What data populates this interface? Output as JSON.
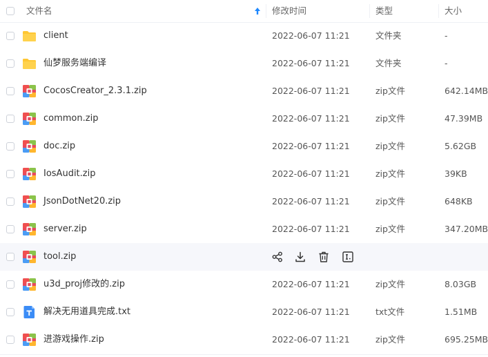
{
  "header": {
    "name": "文件名",
    "modified": "修改时间",
    "type": "类型",
    "size": "大小"
  },
  "actions": [
    "share-icon",
    "download-icon",
    "delete-icon",
    "more-icon"
  ],
  "files": [
    {
      "name": "client",
      "time": "2022-06-07 11:21",
      "type": "文件夹",
      "size": "-",
      "icon": "folder-icon"
    },
    {
      "name": "仙梦服务端编译",
      "time": "2022-06-07 11:21",
      "type": "文件夹",
      "size": "-",
      "icon": "folder-icon"
    },
    {
      "name": "CocosCreator_2.3.1.zip",
      "time": "2022-06-07 11:21",
      "type": "zip文件",
      "size": "642.14MB",
      "icon": "zip-icon"
    },
    {
      "name": "common.zip",
      "time": "2022-06-07 11:21",
      "type": "zip文件",
      "size": "47.39MB",
      "icon": "zip-icon"
    },
    {
      "name": "doc.zip",
      "time": "2022-06-07 11:21",
      "type": "zip文件",
      "size": "5.62GB",
      "icon": "zip-icon"
    },
    {
      "name": "IosAudit.zip",
      "time": "2022-06-07 11:21",
      "type": "zip文件",
      "size": "39KB",
      "icon": "zip-icon"
    },
    {
      "name": "JsonDotNet20.zip",
      "time": "2022-06-07 11:21",
      "type": "zip文件",
      "size": "648KB",
      "icon": "zip-icon"
    },
    {
      "name": "server.zip",
      "time": "2022-06-07 11:21",
      "type": "zip文件",
      "size": "347.20MB",
      "icon": "zip-icon"
    },
    {
      "name": "tool.zip",
      "time": "",
      "type": "",
      "size": "",
      "icon": "zip-icon",
      "hover": true
    },
    {
      "name": "u3d_proj修改的.zip",
      "time": "2022-06-07 11:21",
      "type": "zip文件",
      "size": "8.03GB",
      "icon": "zip-icon"
    },
    {
      "name": "解决无用道具完成.txt",
      "time": "2022-06-07 11:21",
      "type": "txt文件",
      "size": "1.51MB",
      "icon": "txt-icon"
    },
    {
      "name": "进游戏操作.zip",
      "time": "2022-06-07 11:21",
      "type": "zip文件",
      "size": "695.25MB",
      "icon": "zip-icon"
    }
  ]
}
